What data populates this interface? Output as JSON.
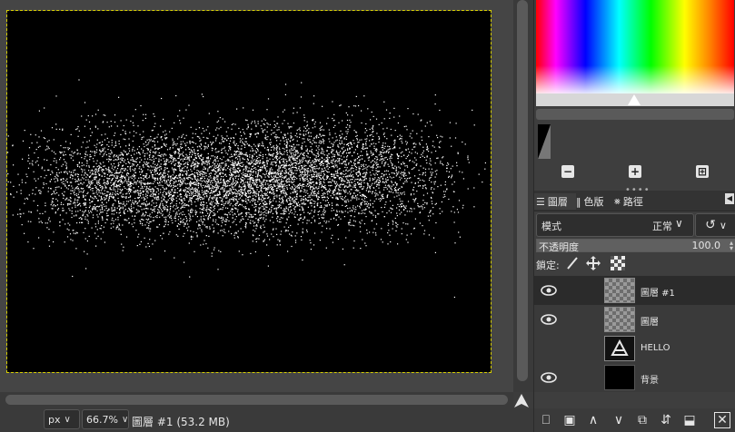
{
  "statusbar": {
    "unit": "px",
    "zoom": "66.7%",
    "status": "圖層 #1 (53.2 MB)"
  },
  "dock": {
    "tabs": [
      {
        "label": "圖層",
        "icon": "layers-icon"
      },
      {
        "label": "色版",
        "icon": "channels-icon"
      },
      {
        "label": "路徑",
        "icon": "paths-icon"
      }
    ],
    "mode_label": "模式",
    "mode_value": "正常",
    "opacity_label": "不透明度",
    "opacity_value": "100.0",
    "lock_label": "鎖定:"
  },
  "layers": [
    {
      "name": "圖層 #1",
      "visible": true,
      "thumb": "checker",
      "selected": true
    },
    {
      "name": "圖層",
      "visible": true,
      "thumb": "checker",
      "selected": false
    },
    {
      "name": "HELLO",
      "visible": false,
      "thumb": "text",
      "selected": false
    },
    {
      "name": "背景",
      "visible": true,
      "thumb": "black",
      "selected": false
    }
  ],
  "colors": {
    "canvas_bg": "#000000",
    "selection_outline": "#d8d000",
    "panel_bg": "#3e3e3e"
  }
}
